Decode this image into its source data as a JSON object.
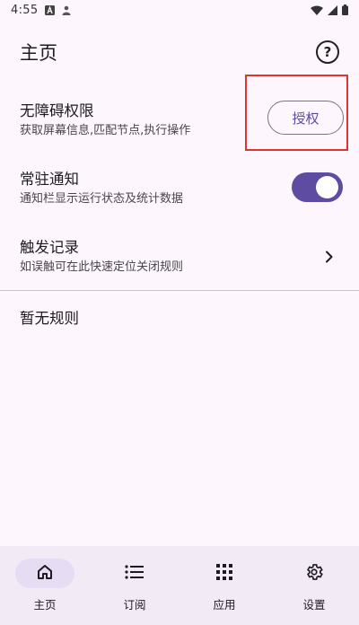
{
  "status_bar": {
    "time": "4:55",
    "icons_left": [
      "a-notification-icon",
      "person-icon"
    ],
    "icons_right": [
      "wifi-icon",
      "cell-signal-icon",
      "battery-icon"
    ]
  },
  "app_bar": {
    "title": "主页",
    "help_icon": "help-circle-icon",
    "help_glyph": "?"
  },
  "accessibility": {
    "title": "无障碍权限",
    "subtitle": "获取屏幕信息,匹配节点,执行操作",
    "button_label": "授权"
  },
  "notification": {
    "title": "常驻通知",
    "subtitle": "通知栏显示运行状态及统计数据",
    "enabled": true
  },
  "trigger_log": {
    "title": "触发记录",
    "subtitle": "如误触可在此快速定位关闭规则"
  },
  "empty_message": "暂无规则",
  "bottom_nav": {
    "items": [
      {
        "label": "主页",
        "icon": "home-icon",
        "active": true
      },
      {
        "label": "订阅",
        "icon": "list-icon",
        "active": false
      },
      {
        "label": "应用",
        "icon": "apps-grid-icon",
        "active": false
      },
      {
        "label": "设置",
        "icon": "settings-gear-icon",
        "active": false
      }
    ]
  },
  "colors": {
    "background": "#fdf7fd",
    "accent": "#5e4ba2",
    "nav_background": "#f2ebf6",
    "highlight": "#e0342f"
  }
}
